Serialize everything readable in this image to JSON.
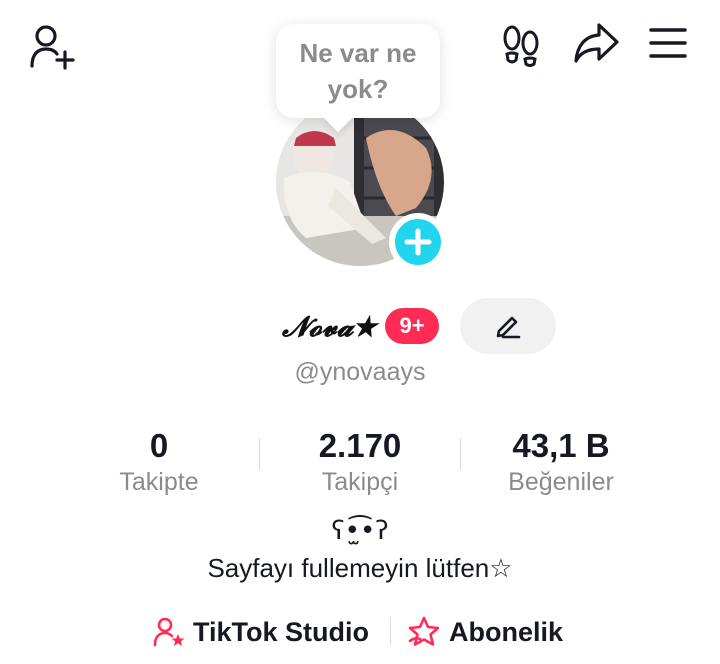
{
  "header": {
    "add_user_icon": "person-plus-icon",
    "footprints_icon": "footprints-icon",
    "share_icon": "share-arrow-icon",
    "menu_icon": "hamburger-menu-icon"
  },
  "note_bubble": {
    "line1": "Ne var ne",
    "line2": "yok?"
  },
  "profile": {
    "display_name": "𝓝𝓸𝓿𝓪★",
    "notification_badge": "9+",
    "username": "@ynovaays"
  },
  "stats": [
    {
      "value": "0",
      "label": "Takipte"
    },
    {
      "value": "2.170",
      "label": "Takipçi"
    },
    {
      "value": "43,1 B",
      "label": "Beğeniler"
    }
  ],
  "bio": {
    "kaomoji": "ʕ•̫͡•ʔ",
    "text": "Sayfayı fullemeyin lütfen☆"
  },
  "links": {
    "studio_label": "TikTok Studio",
    "subscription_label": "Abonelik"
  },
  "colors": {
    "accent": "#fe2c55",
    "plus": "#20d5ec",
    "muted": "#8a8b91"
  }
}
